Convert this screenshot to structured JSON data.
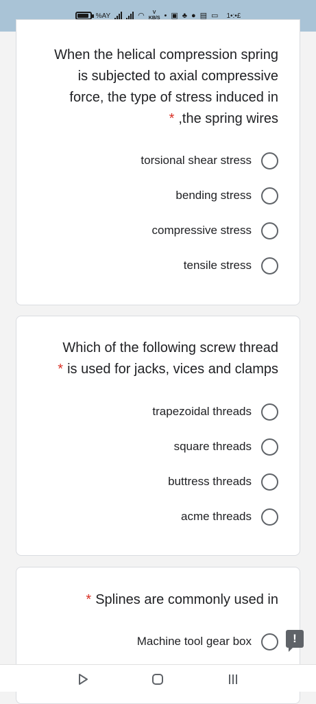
{
  "status_bar": {
    "battery_percent": "%AY",
    "speed_value": "V",
    "speed_unit": "KB/S",
    "time": "1•:•£"
  },
  "questions": [
    {
      "lines": [
        "When the helical compression spring",
        "is subjected to axial compressive",
        "force, the type of stress induced in",
        ",the spring wires"
      ],
      "required_mark": "*",
      "options": [
        "torsional shear stress",
        "bending stress",
        "compressive stress",
        "tensile stress"
      ]
    },
    {
      "lines": [
        "Which of the following screw thread",
        "is used for jacks, vices and clamps"
      ],
      "required_mark": "*",
      "options": [
        "trapezoidal threads",
        "square threads",
        "buttress threads",
        "acme threads"
      ]
    },
    {
      "lines": [
        "Splines are commonly used in"
      ],
      "required_mark": "*",
      "options": [
        "Machine tool gear box"
      ]
    }
  ],
  "feedback_button": {
    "label": "!"
  },
  "icons": [
    "battery-icon",
    "signal-icon",
    "wifi-icon",
    "notification-icons",
    "back-icon",
    "home-icon",
    "recents-icon",
    "feedback-icon"
  ]
}
